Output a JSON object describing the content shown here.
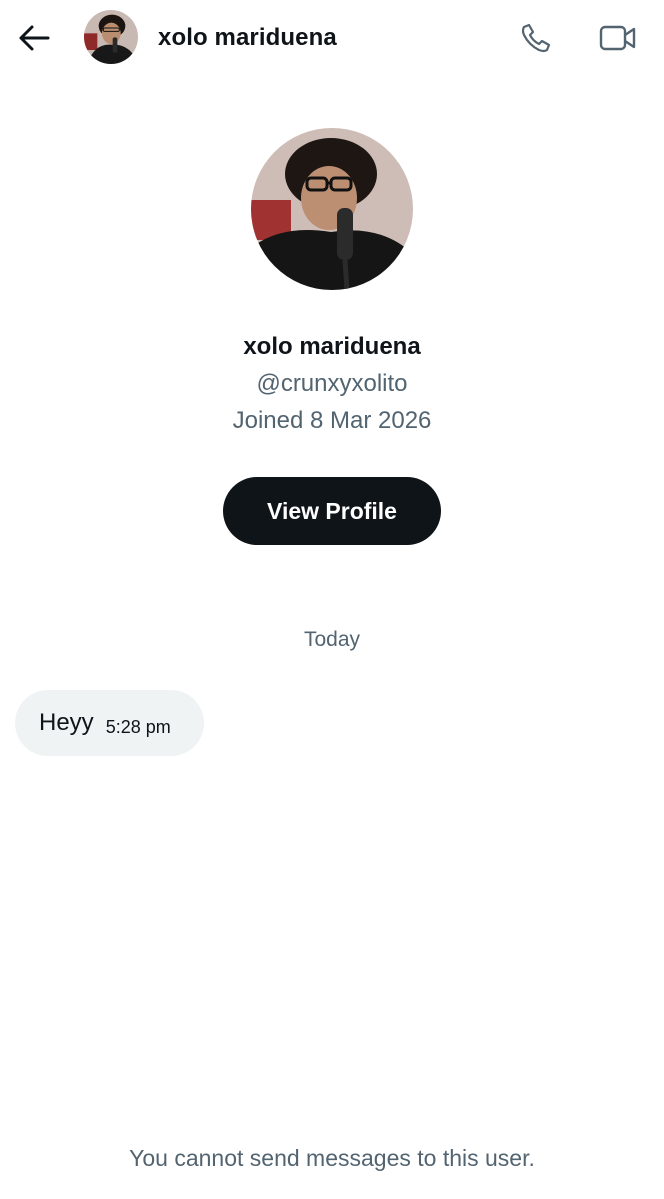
{
  "header": {
    "back_icon": "arrow-left-icon",
    "name": "xolo mariduena",
    "call_icon": "phone-icon",
    "video_icon": "video-camera-icon"
  },
  "profile": {
    "name": "xolo mariduena",
    "handle": "@crunxyxolito",
    "joined": "Joined 8 Mar 2026",
    "view_profile_label": "View Profile"
  },
  "conversation": {
    "date_divider": "Today",
    "messages": [
      {
        "text": "Heyy",
        "time": "5:28 pm"
      }
    ]
  },
  "footer": {
    "notice": "You cannot send messages to this user."
  },
  "colors": {
    "text_primary": "#0f1419",
    "text_secondary": "#536471",
    "button_bg": "#0f1419",
    "bubble_bg": "#eff3f4"
  }
}
